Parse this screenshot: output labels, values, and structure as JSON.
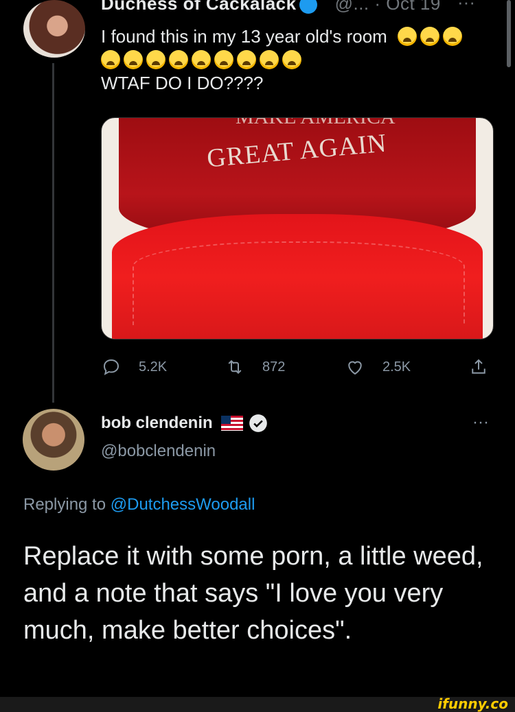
{
  "parent_tweet": {
    "name_cut": "Duchess of Cackalack",
    "meta_cut": "@...  · Oct 19",
    "more": "···",
    "text_line1": "I found this in my 13 year old's room",
    "text_emoji_count_line1": 3,
    "text_emoji_count_line2": 9,
    "text_line3": "WTAF DO I DO????",
    "image": {
      "hat_text_top": "MAKE AMERICA",
      "hat_text": "GREAT AGAIN"
    },
    "actions": {
      "replies": "5.2K",
      "retweets": "872",
      "likes": "2.5K"
    }
  },
  "reply": {
    "name": "bob clendenin",
    "handle": "@bobclendenin",
    "more": "···",
    "replying_prefix": "Replying to",
    "replying_handle": "@DutchessWoodall",
    "body": "Replace it with some porn, a little weed, and a note that says \"I love you very much, make better choices\"."
  },
  "watermark": "ifunny.co",
  "colors": {
    "background": "#000000",
    "link": "#1d9bf0",
    "muted": "#8b98a5",
    "text": "#e7e9ea"
  }
}
